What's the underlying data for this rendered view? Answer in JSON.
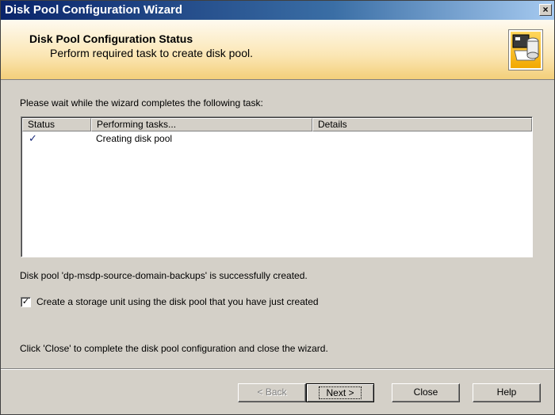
{
  "window": {
    "title": "Disk Pool Configuration Wizard",
    "close_glyph": "×"
  },
  "header": {
    "title": "Disk Pool Configuration Status",
    "subtitle": "Perform required task to create disk pool.",
    "logo_icon": "disk-pool-wizard-icon"
  },
  "intro_text": "Please wait while the wizard completes the following task:",
  "task_list": {
    "columns": [
      "Status",
      "Performing tasks...",
      "Details"
    ],
    "rows": [
      {
        "status": "✓",
        "task": "Creating disk pool",
        "details": ""
      }
    ]
  },
  "success_text": "Disk pool 'dp-msdp-source-domain-backups' is successfully created.",
  "checkbox": {
    "checked": true,
    "glyph": "✓",
    "label": "Create a storage unit using the disk pool that you have just created"
  },
  "instruction_text": "Click 'Close' to complete the disk pool configuration and close the wizard.",
  "buttons": {
    "back": "< Back",
    "next": "Next >",
    "close": "Close",
    "help": "Help"
  },
  "colors": {
    "titlebar": "#0a246a",
    "header_accent": "#f3cf7a",
    "face": "#d4d0c8"
  }
}
